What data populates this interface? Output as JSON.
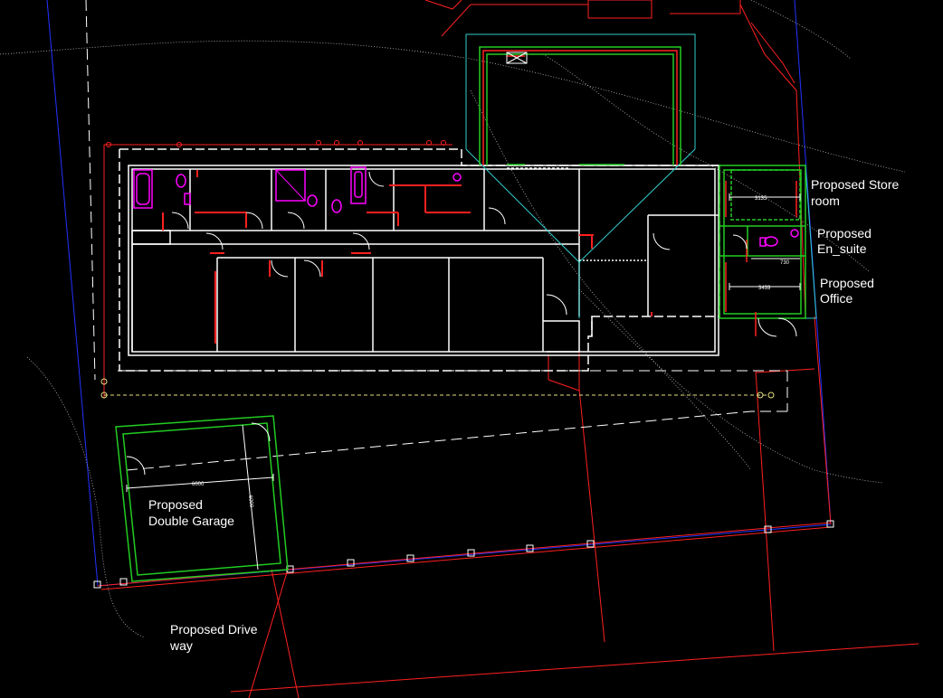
{
  "labels": {
    "store_room_line1": "Proposed Store",
    "store_room_line2": "room",
    "en_suite_line1": "Proposed",
    "en_suite_line2": "En_suite",
    "office_line1": "Proposed",
    "office_line2": "Office",
    "garage_line1": "Proposed",
    "garage_line2": "Double Garage",
    "drive_line1": "Proposed Drive",
    "drive_line2": "way"
  },
  "dimensions": {
    "store_width": "3135",
    "office_width": "3439",
    "ensuite_width": "730",
    "garage_width": "6000",
    "garage_depth": "6000"
  },
  "colors": {
    "background": "#000000",
    "wall": "#ffffff",
    "boundary": "#ff2020",
    "proposed": "#22cc22",
    "site_line": "#2233ff",
    "sanitary": "#ff00ff",
    "extension_outline": "#33cccc",
    "setback": "#e8e080"
  }
}
